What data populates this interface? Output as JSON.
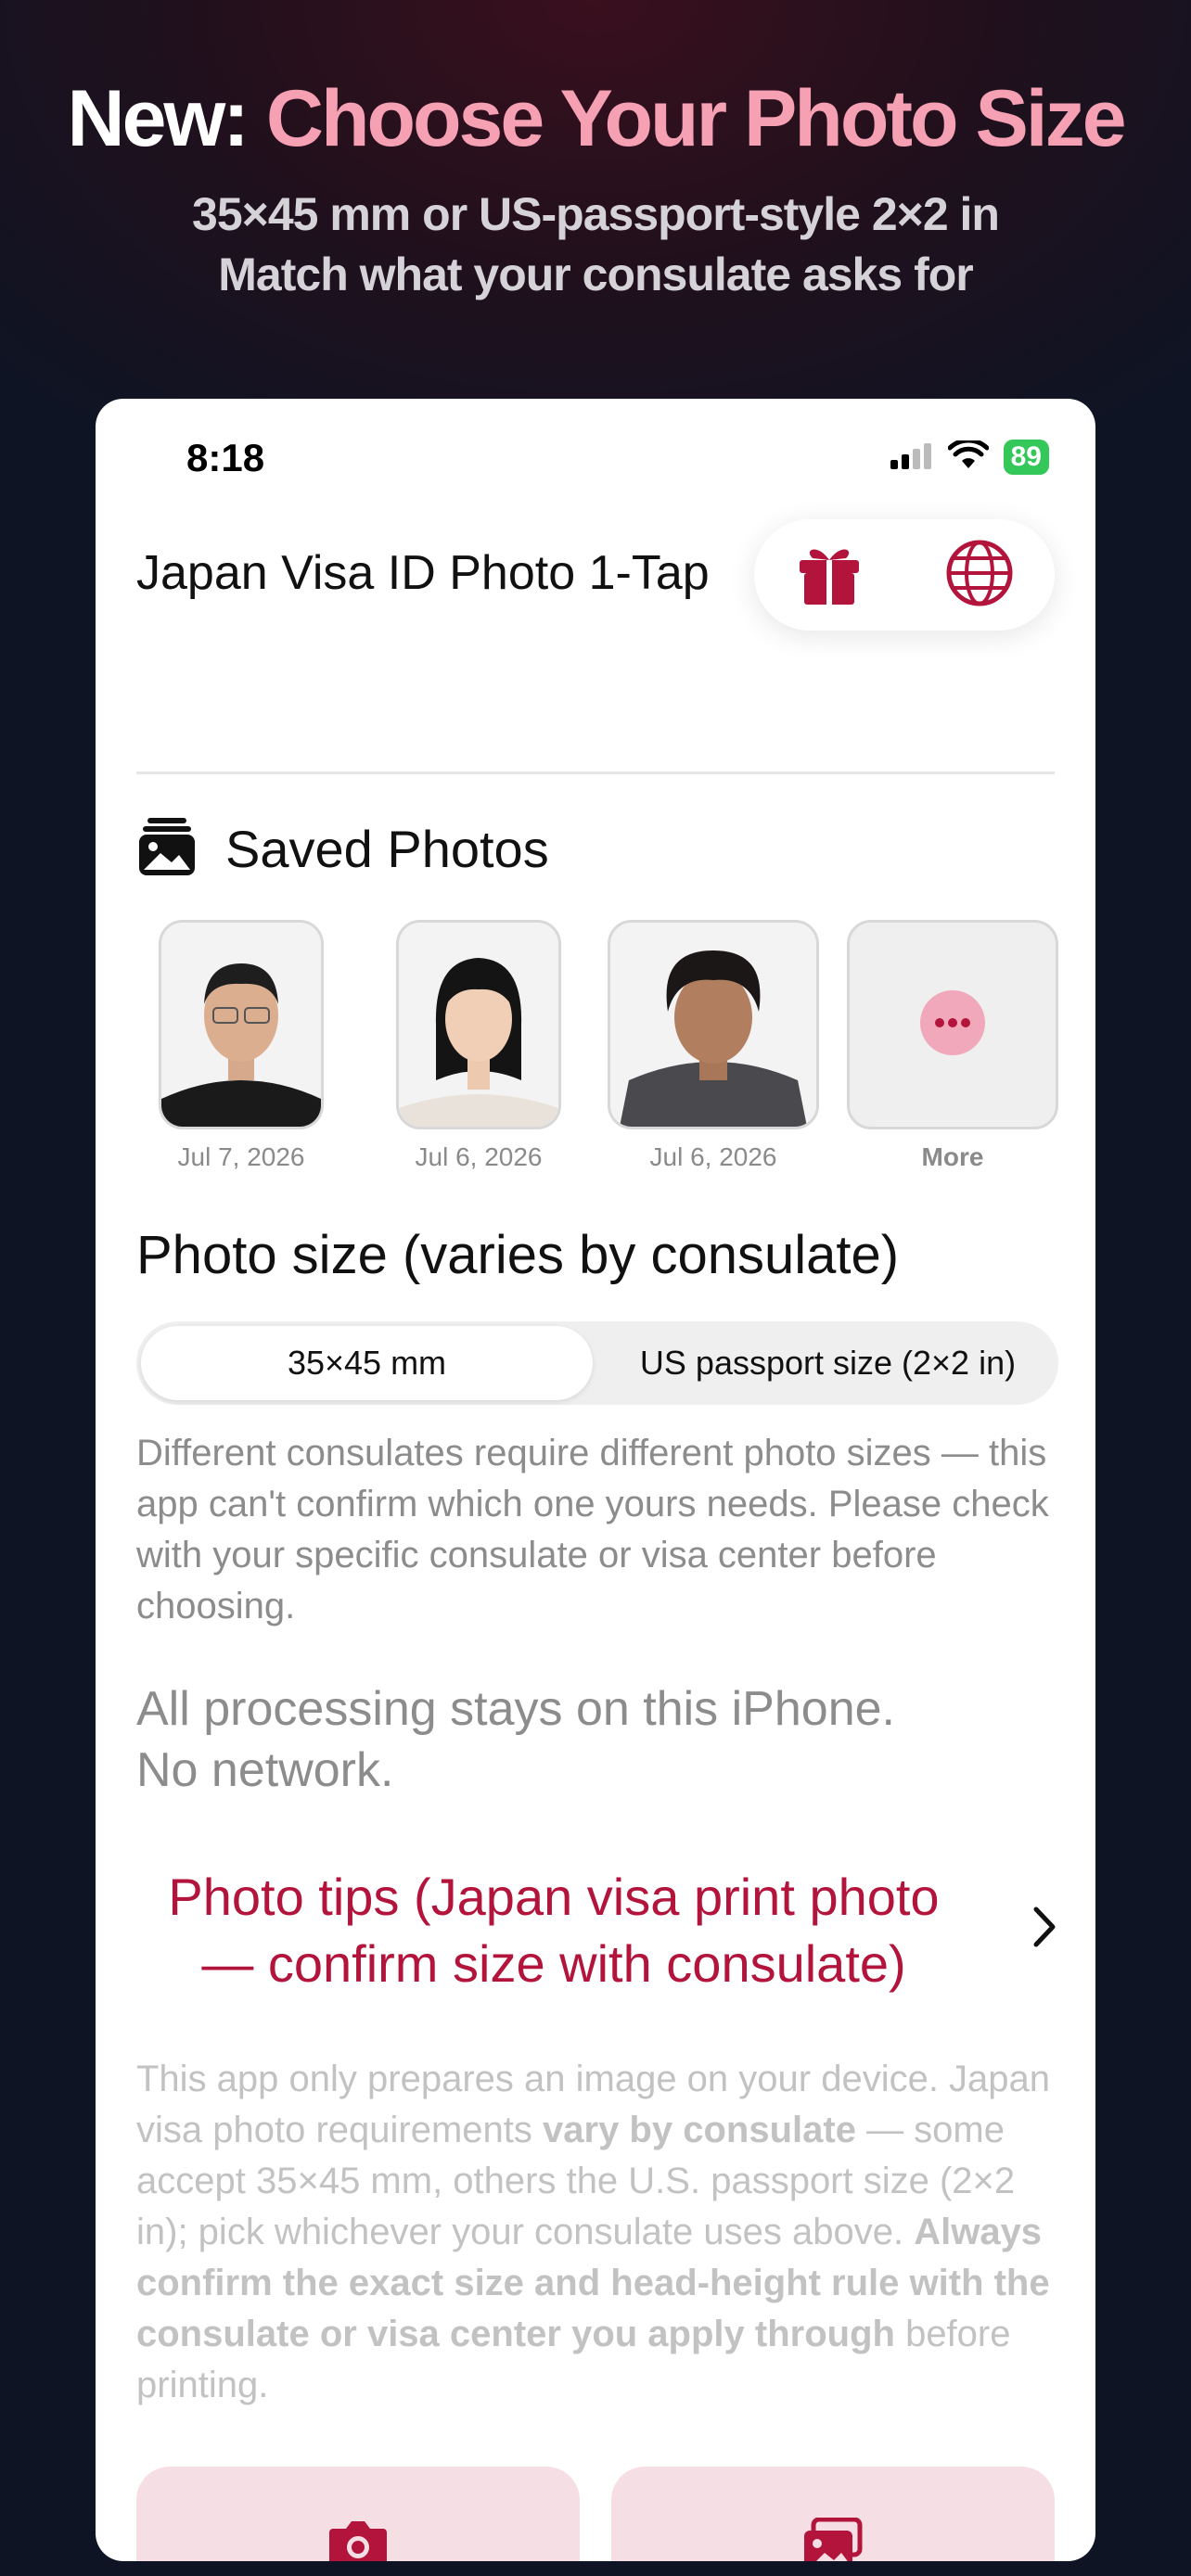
{
  "promo": {
    "headline_prefix": "New: ",
    "headline_accent": "Choose Your Photo Size",
    "subtitle_line1": "35×45 mm or US-passport-style 2×2 in",
    "subtitle_line2": "Match what your consulate asks for"
  },
  "status_bar": {
    "time": "8:18",
    "battery": "89"
  },
  "app": {
    "title": "Japan Visa ID Photo 1-Tap",
    "gift_icon": "gift-icon",
    "globe_icon": "globe-icon"
  },
  "saved_photos": {
    "title": "Saved Photos",
    "items": [
      {
        "date": "Jul 7, 2026"
      },
      {
        "date": "Jul 6, 2026"
      },
      {
        "date": "Jul 6, 2026"
      }
    ],
    "more_label": "More"
  },
  "photo_size": {
    "title": "Photo size (varies by consulate)",
    "options": [
      "35×45 mm",
      "US passport size (2×2 in)"
    ],
    "selected": "35×45 mm",
    "disclaimer": "Different consulates require different photo sizes — this app can't confirm which one yours needs. Please check with your specific consulate or visa center before choosing."
  },
  "privacy": {
    "line1": "All processing stays on this iPhone.",
    "line2": "No network."
  },
  "tips": {
    "line1": "Photo tips (Japan visa print photo",
    "line2": "— confirm size with consulate)"
  },
  "legal": {
    "part1": "This app only prepares an image on your device. Japan visa photo requirements ",
    "bold1": "vary by consulate",
    "part2": " — some accept 35×45 mm, others the U.S. passport size (2×2 in); pick whichever your consulate uses above. ",
    "bold2": "Always confirm the exact size and head-height rule with the consulate or visa center you apply through",
    "part3": " before printing."
  },
  "colors": {
    "accent_red": "#b3143c",
    "accent_pink": "#f6a0b4",
    "battery_green": "#34c759"
  }
}
